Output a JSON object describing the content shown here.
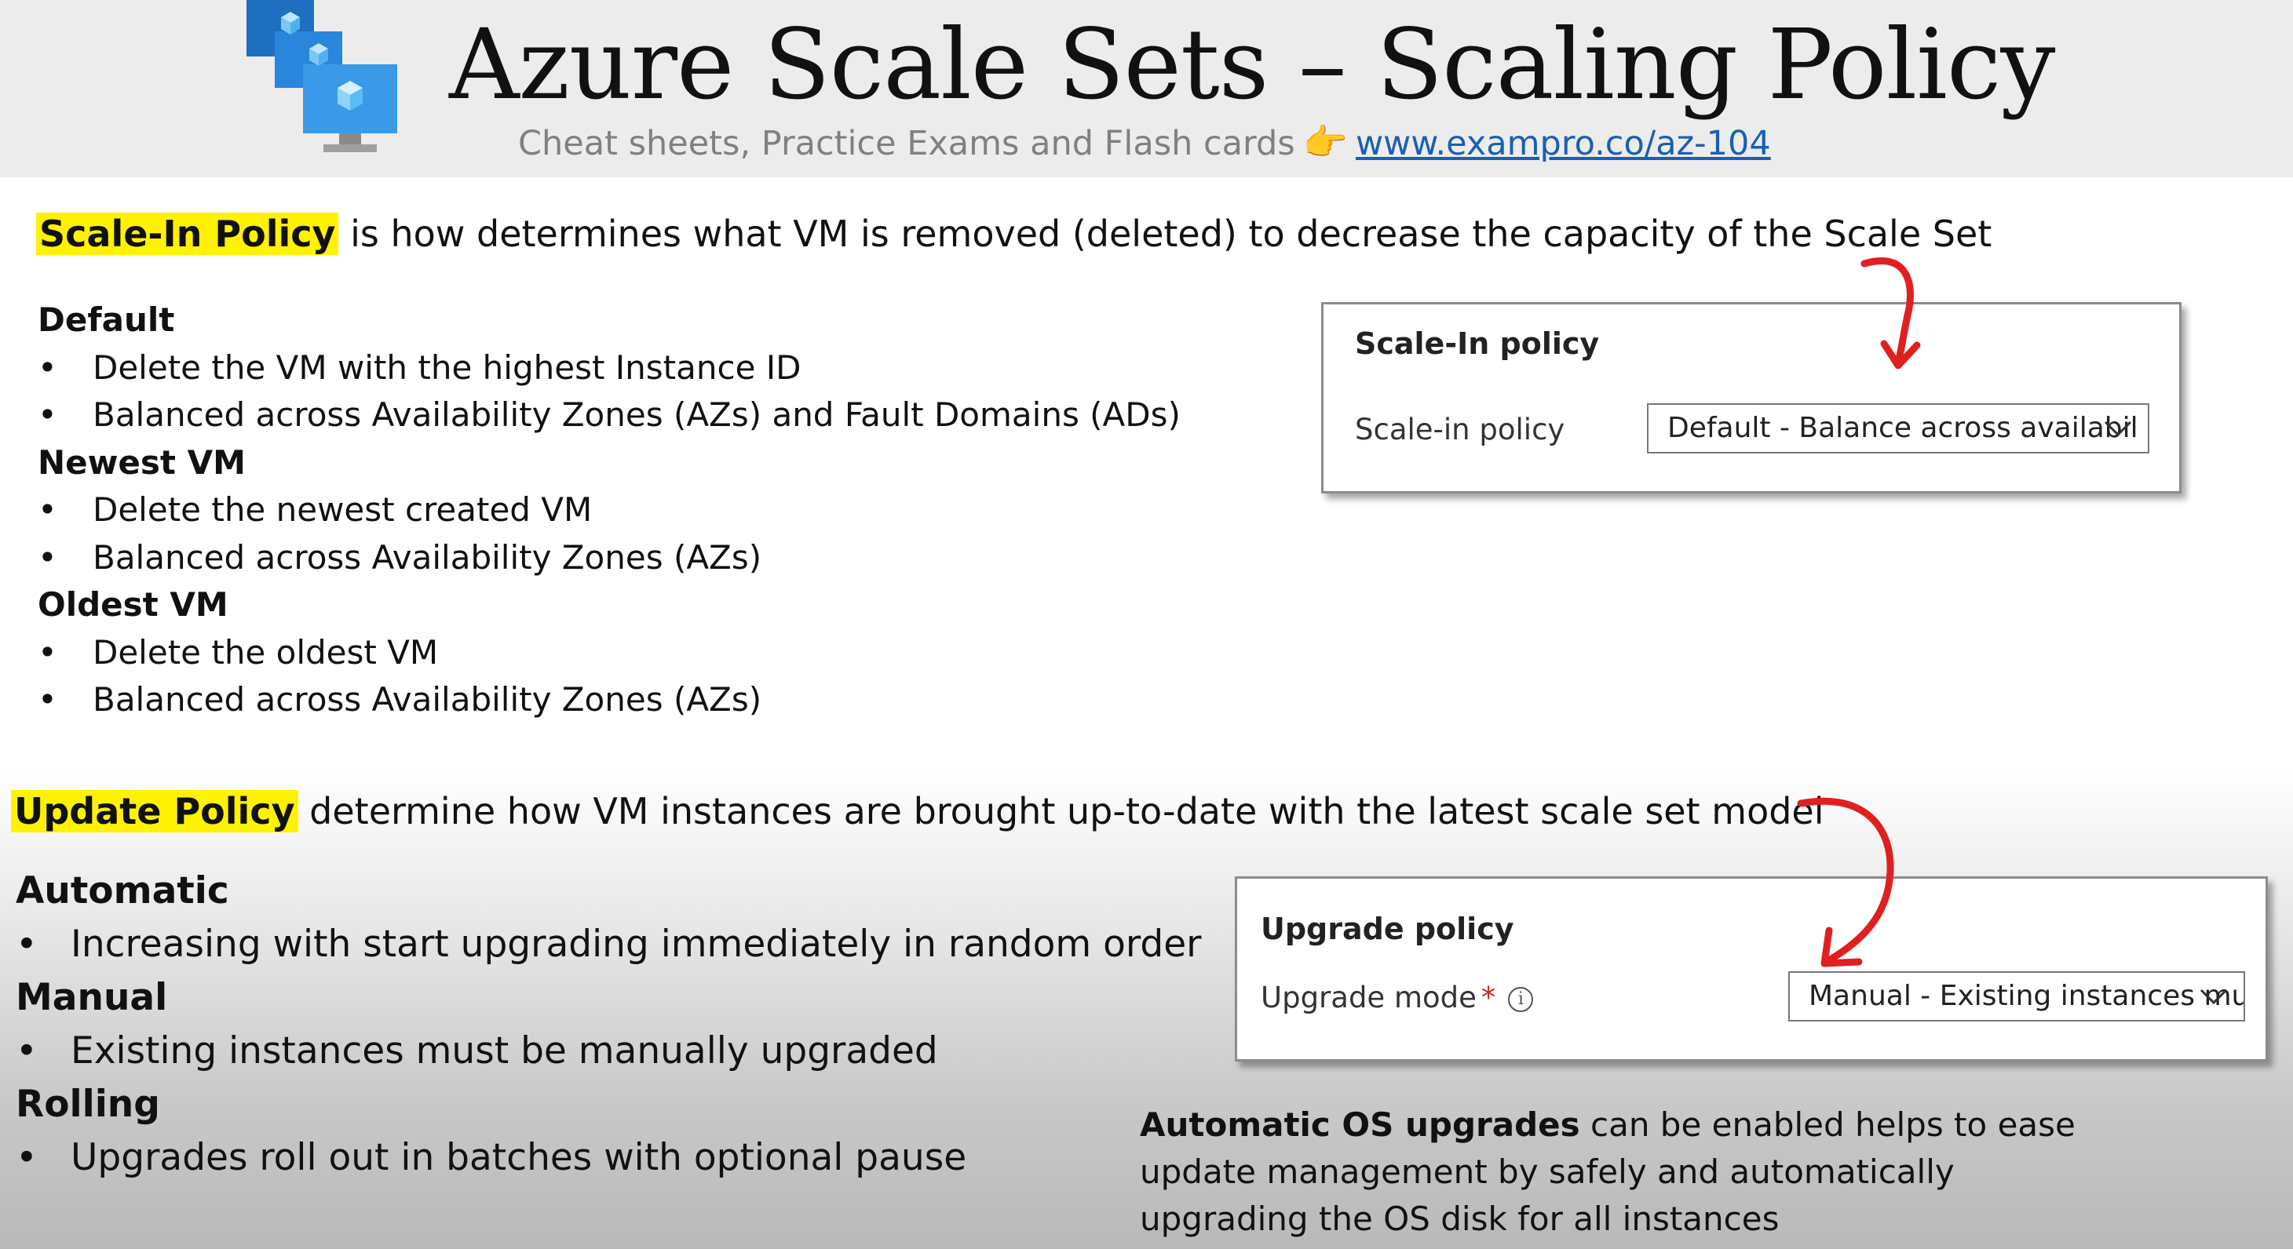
{
  "header": {
    "title": "Azure Scale Sets – Scaling Policy",
    "subtitle": "Cheat sheets, Practice Exams and Flash cards",
    "hand_emoji": "👉",
    "link": "www.exampro.co/az-104"
  },
  "scale_in": {
    "highlight": "Scale-In Policy",
    "intro_rest": " is how determines what VM is removed (deleted) to decrease the capacity of the Scale Set",
    "sections": [
      {
        "heading": "Default",
        "bullets": [
          "Delete the VM with the highest Instance ID",
          "Balanced across Availability Zones (AZs) and Fault Domains (ADs)"
        ]
      },
      {
        "heading": "Newest VM",
        "bullets": [
          "Delete the newest created VM",
          "Balanced across Availability Zones (AZs)"
        ]
      },
      {
        "heading": "Oldest VM",
        "bullets": [
          "Delete the oldest VM",
          "Balanced across Availability Zones (AZs)"
        ]
      }
    ],
    "panel": {
      "title": "Scale-In policy",
      "label": "Scale-in policy",
      "value": "Default - Balance across availabil"
    }
  },
  "update": {
    "highlight": "Update Policy",
    "intro_rest": " determine how VM instances are brought up-to-date with the latest scale set model",
    "sections": [
      {
        "heading": "Automatic",
        "bullets": [
          "Increasing with start upgrading immediately in random order"
        ]
      },
      {
        "heading": "Manual",
        "bullets": [
          "Existing instances must be manually upgraded"
        ]
      },
      {
        "heading": "Rolling",
        "bullets": [
          "Upgrades roll out in batches with optional pause"
        ]
      }
    ],
    "panel": {
      "title": "Upgrade policy",
      "label": "Upgrade mode",
      "required_mark": "*",
      "info_glyph": "i",
      "value": "Manual - Existing instances mu"
    },
    "note": {
      "bold": "Automatic OS upgrades",
      "line1_rest": " can be enabled  helps to ease",
      "line2": "update management by safely and automatically",
      "line3": "upgrading the OS disk for all instances"
    }
  },
  "colors": {
    "highlight": "#fff200",
    "link": "#1a5fb4",
    "annotation_arrow": "#e02020",
    "azure_blue": "#1f7ad6"
  },
  "icons": [
    "azure-vm-scale-set-icon",
    "pointing-hand-icon",
    "chevron-down-icon",
    "info-icon",
    "red-arrow"
  ]
}
